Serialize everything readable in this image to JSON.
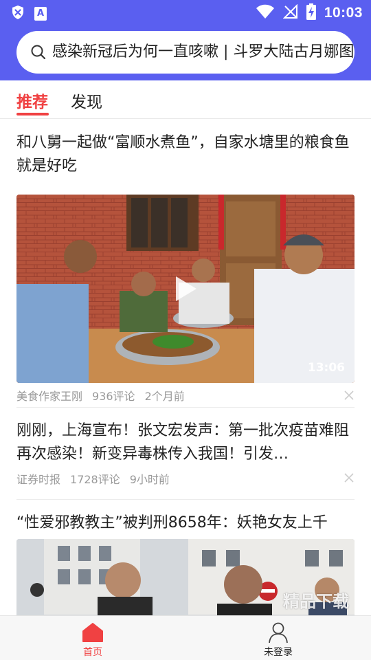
{
  "status_bar": {
    "time": "10:03",
    "left_icons": [
      "shield-x-icon",
      "app-a-icon"
    ],
    "app_badge_letter": "A",
    "right_icons": [
      "wifi-icon",
      "no-signal-icon",
      "battery-charging-icon"
    ]
  },
  "search": {
    "icon": "search-icon",
    "text": "感染新冠后为何一直咳嗽 | 斗罗大陆古月娜图"
  },
  "tabs": [
    {
      "label": "推荐",
      "active": true
    },
    {
      "label": "发现",
      "active": false
    }
  ],
  "feed": {
    "items": [
      {
        "title": "和八舅一起做“富顺水煮鱼”，自家水塘里的粮食鱼就是好吃",
        "duration": "13:06",
        "source": "美食作家王刚",
        "comments": "936评论",
        "time": "2个月前"
      },
      {
        "title": "刚刚，上海宣布！张文宏发声：第一批次疫苗难阻再次感染！新变异毒株传入我国！引发…",
        "source": "证券时报",
        "comments": "1728评论",
        "time": "9小时前"
      },
      {
        "title": "“性爱邪教教主”被判刑8658年：妖艳女友上千"
      }
    ]
  },
  "bottom_nav": {
    "items": [
      {
        "label": "首页",
        "icon": "home-icon",
        "active": true
      },
      {
        "label": "未登录",
        "icon": "user-icon",
        "active": false
      }
    ]
  },
  "watermark": "精品下载",
  "colors": {
    "header": "#5a5ff0",
    "accent": "#f04142"
  }
}
